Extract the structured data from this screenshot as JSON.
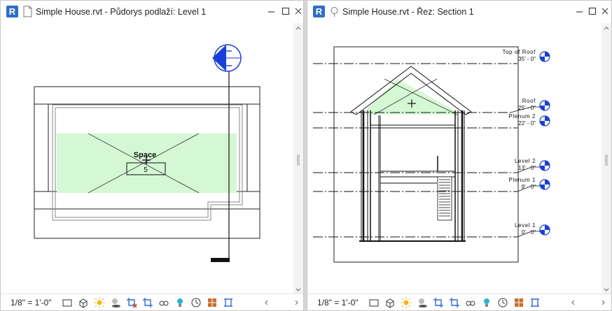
{
  "left_view": {
    "app_badge": "R",
    "title": "Simple House.rvt - Půdorys podlaží: Level 1",
    "space_name": "Space",
    "space_number": "5",
    "scale": "1/8\" = 1'-0\""
  },
  "right_view": {
    "app_badge": "R",
    "title": "Simple House.rvt - Řez: Section 1",
    "scale": "1/8\" = 1'-0\"",
    "levels": [
      {
        "name": "Top of Roof",
        "elevation": "35' - 0\""
      },
      {
        "name": "Roof",
        "elevation": "25' - 0\""
      },
      {
        "name": "Plenum 2",
        "elevation": "22' - 0\""
      },
      {
        "name": "Level 2",
        "elevation": "13' - 0\""
      },
      {
        "name": "Plenum 1",
        "elevation": "9' - 0\""
      },
      {
        "name": "Level 1",
        "elevation": "0' - 0\""
      }
    ]
  },
  "colors": {
    "space_fill": "#d4f7d4",
    "section_marker": "#1a3fd8",
    "app_badge": "#2e6ec4"
  },
  "status_icons": [
    "model-graphics-icon",
    "3d-view-icon",
    "sun-icon",
    "shadows-icon",
    "crop-icon",
    "hide-crop-icon",
    "temp-hide-icon",
    "reveal-hidden-icon",
    "lightbulb-icon",
    "worksharing-icon",
    "analytic-model-icon",
    "constraints-icon"
  ]
}
